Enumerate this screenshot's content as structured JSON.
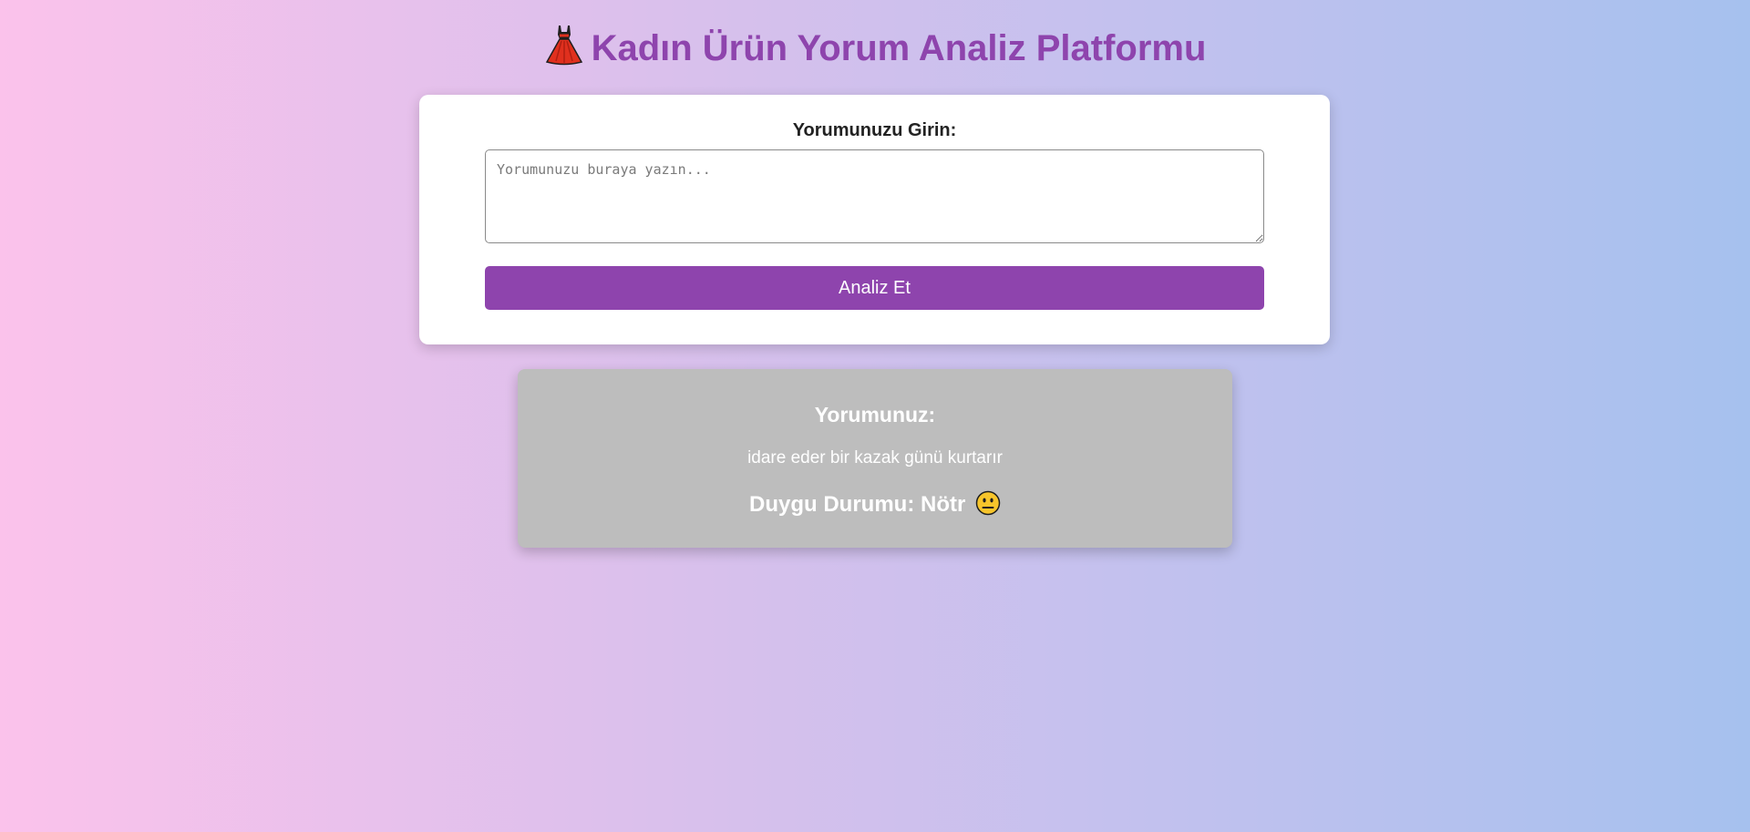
{
  "header": {
    "title": "Kadın Ürün Yorum Analiz Platformu",
    "icon": "dress-icon"
  },
  "form": {
    "label": "Yorumunuzu Girin:",
    "input_value": "",
    "input_placeholder": "Yorumunuzu buraya yazın...",
    "button_label": "Analiz Et"
  },
  "result": {
    "heading": "Yorumunuz:",
    "comment": "idare eder bir kazak günü kurtarır",
    "sentiment_text": "Duygu Durumu: Nötr",
    "sentiment_icon": "neutral-face-icon"
  },
  "colors": {
    "accent": "#8e44ad",
    "card_background": "#ffffff",
    "result_background": "#bdbdbd",
    "gradient_start": "#fbc2eb",
    "gradient_end": "#a6c1ee"
  }
}
